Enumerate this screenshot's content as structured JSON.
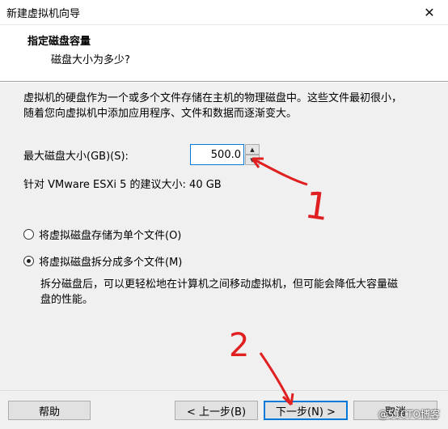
{
  "window": {
    "title": "新建虚拟机向导",
    "close_glyph": "✕"
  },
  "header": {
    "heading": "指定磁盘容量",
    "subheading": "磁盘大小为多少?"
  },
  "body": {
    "description": "虚拟机的硬盘作为一个或多个文件存储在主机的物理磁盘中。这些文件最初很小，随着您向虚拟机中添加应用程序、文件和数据而逐渐变大。",
    "max_size_label": "最大磁盘大小(GB)(S):",
    "max_size_value": "500.0",
    "recommended": "针对 VMware ESXi 5 的建议大小: 40 GB",
    "options": [
      {
        "label": "将虚拟磁盘存储为单个文件(O)",
        "selected": false
      },
      {
        "label": "将虚拟磁盘拆分成多个文件(M)",
        "selected": true
      }
    ],
    "split_description": "拆分磁盘后，可以更轻松地在计算机之间移动虚拟机，但可能会降低大容量磁盘的性能。"
  },
  "footer": {
    "help": "帮助",
    "back": "< 上一步(B)",
    "next": "下一步(N) >",
    "cancel": "取消"
  },
  "annotations": {
    "mark_1": "1",
    "mark_2": "2",
    "color": "#e02020"
  },
  "watermark": "@51CTO博客"
}
